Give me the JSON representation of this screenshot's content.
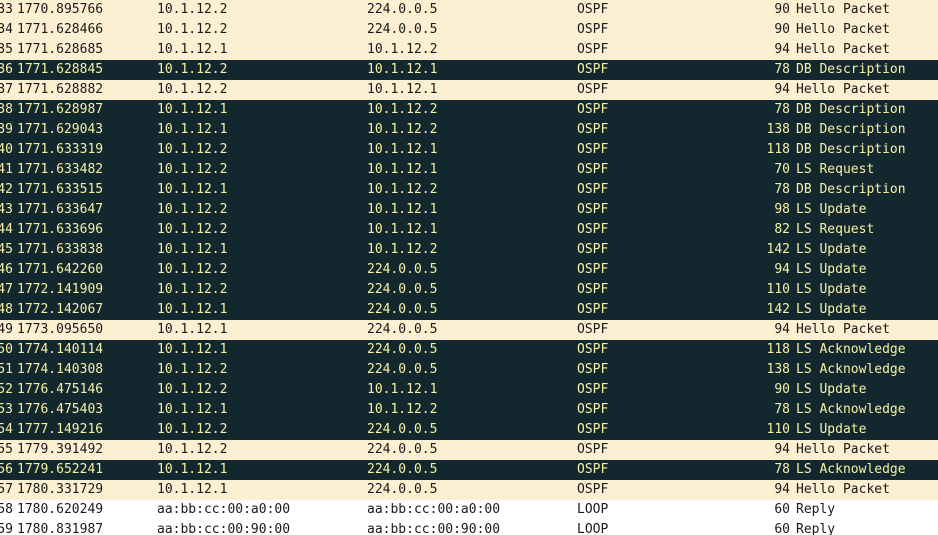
{
  "packets": [
    {
      "no": "33",
      "time": "1770.895766",
      "src": "10.1.12.2",
      "dst": "224.0.0.5",
      "proto": "OSPF",
      "len": "90",
      "info": "Hello Packet",
      "style": "hello"
    },
    {
      "no": "34",
      "time": "1771.628466",
      "src": "10.1.12.2",
      "dst": "224.0.0.5",
      "proto": "OSPF",
      "len": "90",
      "info": "Hello Packet",
      "style": "hello"
    },
    {
      "no": "35",
      "time": "1771.628685",
      "src": "10.1.12.1",
      "dst": "10.1.12.2",
      "proto": "OSPF",
      "len": "94",
      "info": "Hello Packet",
      "style": "hello"
    },
    {
      "no": "36",
      "time": "1771.628845",
      "src": "10.1.12.2",
      "dst": "10.1.12.1",
      "proto": "OSPF",
      "len": "78",
      "info": "DB Description",
      "style": "dark"
    },
    {
      "no": "37",
      "time": "1771.628882",
      "src": "10.1.12.2",
      "dst": "10.1.12.1",
      "proto": "OSPF",
      "len": "94",
      "info": "Hello Packet",
      "style": "hello"
    },
    {
      "no": "38",
      "time": "1771.628987",
      "src": "10.1.12.1",
      "dst": "10.1.12.2",
      "proto": "OSPF",
      "len": "78",
      "info": "DB Description",
      "style": "dark"
    },
    {
      "no": "39",
      "time": "1771.629043",
      "src": "10.1.12.1",
      "dst": "10.1.12.2",
      "proto": "OSPF",
      "len": "138",
      "info": "DB Description",
      "style": "dark"
    },
    {
      "no": "40",
      "time": "1771.633319",
      "src": "10.1.12.2",
      "dst": "10.1.12.1",
      "proto": "OSPF",
      "len": "118",
      "info": "DB Description",
      "style": "dark"
    },
    {
      "no": "41",
      "time": "1771.633482",
      "src": "10.1.12.2",
      "dst": "10.1.12.1",
      "proto": "OSPF",
      "len": "70",
      "info": "LS Request",
      "style": "dark"
    },
    {
      "no": "42",
      "time": "1771.633515",
      "src": "10.1.12.1",
      "dst": "10.1.12.2",
      "proto": "OSPF",
      "len": "78",
      "info": "DB Description",
      "style": "dark"
    },
    {
      "no": "43",
      "time": "1771.633647",
      "src": "10.1.12.2",
      "dst": "10.1.12.1",
      "proto": "OSPF",
      "len": "98",
      "info": "LS Update",
      "style": "dark"
    },
    {
      "no": "44",
      "time": "1771.633696",
      "src": "10.1.12.2",
      "dst": "10.1.12.1",
      "proto": "OSPF",
      "len": "82",
      "info": "LS Request",
      "style": "dark"
    },
    {
      "no": "45",
      "time": "1771.633838",
      "src": "10.1.12.1",
      "dst": "10.1.12.2",
      "proto": "OSPF",
      "len": "142",
      "info": "LS Update",
      "style": "dark"
    },
    {
      "no": "46",
      "time": "1771.642260",
      "src": "10.1.12.2",
      "dst": "224.0.0.5",
      "proto": "OSPF",
      "len": "94",
      "info": "LS Update",
      "style": "dark"
    },
    {
      "no": "47",
      "time": "1772.141909",
      "src": "10.1.12.2",
      "dst": "224.0.0.5",
      "proto": "OSPF",
      "len": "110",
      "info": "LS Update",
      "style": "dark"
    },
    {
      "no": "48",
      "time": "1772.142067",
      "src": "10.1.12.1",
      "dst": "224.0.0.5",
      "proto": "OSPF",
      "len": "142",
      "info": "LS Update",
      "style": "dark"
    },
    {
      "no": "49",
      "time": "1773.095650",
      "src": "10.1.12.1",
      "dst": "224.0.0.5",
      "proto": "OSPF",
      "len": "94",
      "info": "Hello Packet",
      "style": "hello"
    },
    {
      "no": "50",
      "time": "1774.140114",
      "src": "10.1.12.1",
      "dst": "224.0.0.5",
      "proto": "OSPF",
      "len": "118",
      "info": "LS Acknowledge",
      "style": "dark"
    },
    {
      "no": "51",
      "time": "1774.140308",
      "src": "10.1.12.2",
      "dst": "224.0.0.5",
      "proto": "OSPF",
      "len": "138",
      "info": "LS Acknowledge",
      "style": "dark"
    },
    {
      "no": "52",
      "time": "1776.475146",
      "src": "10.1.12.2",
      "dst": "10.1.12.1",
      "proto": "OSPF",
      "len": "90",
      "info": "LS Update",
      "style": "dark"
    },
    {
      "no": "53",
      "time": "1776.475403",
      "src": "10.1.12.1",
      "dst": "10.1.12.2",
      "proto": "OSPF",
      "len": "78",
      "info": "LS Acknowledge",
      "style": "dark"
    },
    {
      "no": "54",
      "time": "1777.149216",
      "src": "10.1.12.2",
      "dst": "224.0.0.5",
      "proto": "OSPF",
      "len": "110",
      "info": "LS Update",
      "style": "dark"
    },
    {
      "no": "55",
      "time": "1779.391492",
      "src": "10.1.12.2",
      "dst": "224.0.0.5",
      "proto": "OSPF",
      "len": "94",
      "info": "Hello Packet",
      "style": "hello"
    },
    {
      "no": "56",
      "time": "1779.652241",
      "src": "10.1.12.1",
      "dst": "224.0.0.5",
      "proto": "OSPF",
      "len": "78",
      "info": "LS Acknowledge",
      "style": "dark"
    },
    {
      "no": "57",
      "time": "1780.331729",
      "src": "10.1.12.1",
      "dst": "224.0.0.5",
      "proto": "OSPF",
      "len": "94",
      "info": "Hello Packet",
      "style": "hello"
    },
    {
      "no": "58",
      "time": "1780.620249",
      "src": "aa:bb:cc:00:a0:00",
      "dst": "aa:bb:cc:00:a0:00",
      "proto": "LOOP",
      "len": "60",
      "info": "Reply",
      "style": "white"
    },
    {
      "no": "59",
      "time": "1780.831987",
      "src": "aa:bb:cc:00:90:00",
      "dst": "aa:bb:cc:00:90:00",
      "proto": "LOOP",
      "len": "60",
      "info": "Reply",
      "style": "white"
    }
  ]
}
